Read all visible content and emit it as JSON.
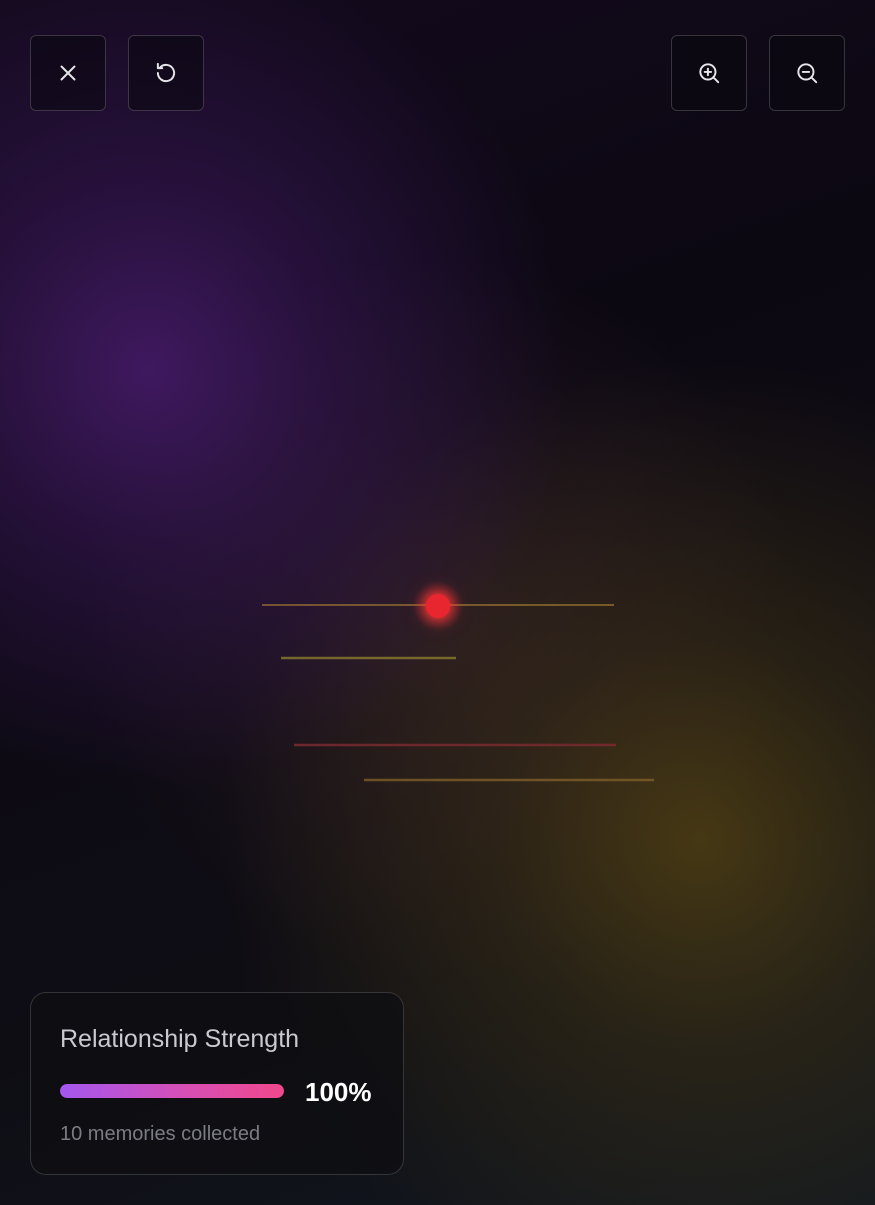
{
  "toolbar": {
    "close": {
      "icon": "close-icon"
    },
    "reset": {
      "icon": "reset-icon"
    },
    "zoom_in": {
      "icon": "zoom-in-icon"
    },
    "zoom_out": {
      "icon": "zoom-out-icon"
    }
  },
  "graph": {
    "focus_node": {
      "color": "#e8262f"
    }
  },
  "strength_panel": {
    "title": "Relationship Strength",
    "value_text": "100%",
    "value_fraction": 1.0,
    "subtitle": "10 memories collected"
  },
  "colors": {
    "accent_gradient_start": "#a457f0",
    "accent_gradient_end": "#f0488c",
    "purple_glow": "#48186c",
    "gold_glow": "#584614"
  }
}
